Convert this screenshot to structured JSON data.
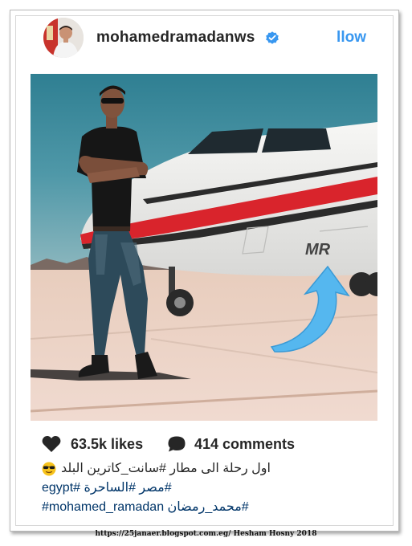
{
  "post": {
    "username": "mohamedramadanws",
    "follow_label": "llow",
    "likes": "63.5k likes",
    "comments": "414 comments",
    "caption_line1": "اول رحلة الى مطار  #سانت_كاترين البلد ",
    "caption_line2_tags": [
      "#مصر",
      "#الساحرة",
      "#egypt"
    ],
    "caption_line3_tags": [
      "#mohamed_ramadan",
      "#محمد_رمضان"
    ],
    "plane_marking": "MR"
  },
  "footer": {
    "credit": "https://25janaer.blogspot.com.eg/  Hesham Hosny 2018"
  },
  "colors": {
    "link_blue": "#3897f0",
    "hashtag": "#003569",
    "text": "#262626",
    "arrow": "#55b7ef",
    "plane_red": "#d9242c"
  },
  "icons": [
    "verified-badge-icon",
    "heart-icon",
    "comment-bubble-icon",
    "sunglasses-emoji-icon"
  ]
}
